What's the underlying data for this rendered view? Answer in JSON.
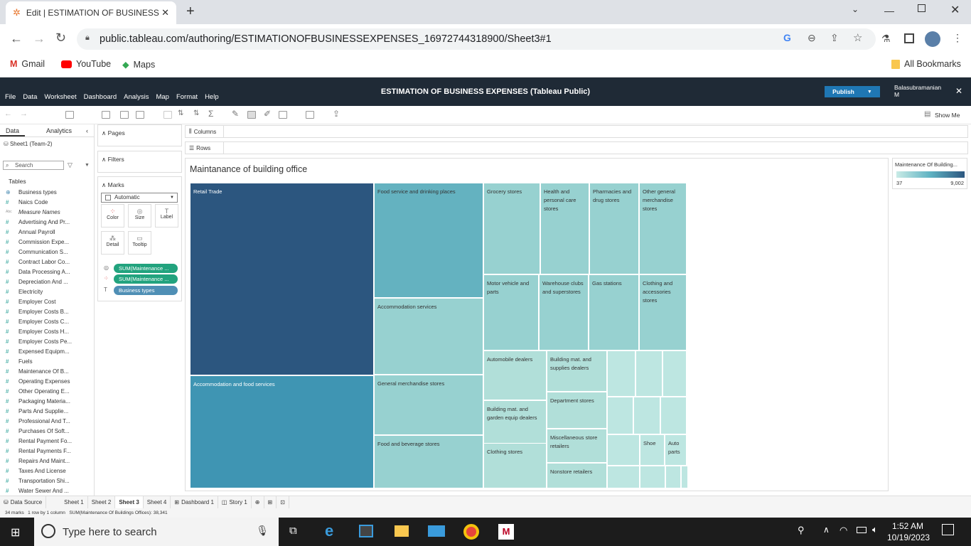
{
  "browser": {
    "tab_title": "Edit | ESTIMATION OF BUSINESS",
    "url": "public.tableau.com/authoring/ESTIMATIONOFBUSINESSEXPENSES_16972744318900/Sheet3#1",
    "bookmarks": [
      "Gmail",
      "YouTube",
      "Maps"
    ],
    "all_bookmarks": "All Bookmarks"
  },
  "app": {
    "title": "ESTIMATION OF BUSINESS EXPENSES (Tableau Public)",
    "menu": [
      "File",
      "Data",
      "Worksheet",
      "Dashboard",
      "Analysis",
      "Map",
      "Format",
      "Help"
    ],
    "publish": "Publish",
    "user_line1": "Balasubramanian",
    "user_line2": "M",
    "show_me": "Show Me"
  },
  "datapane": {
    "tab_data": "Data",
    "tab_analytics": "Analytics",
    "source": "Sheet1 (Team-2)",
    "search_placeholder": "Search",
    "tables_label": "Tables",
    "fields": [
      "Business types",
      "Naics Code",
      "Measure Names",
      "Advertising And Pr...",
      "Annual Payroll",
      "Commission Expe...",
      "Communication S...",
      "Contract Labor Co...",
      "Data Processing A...",
      "Depreciation And ...",
      "Electricity",
      "Employer Cost",
      "Employer Costs B...",
      "Employer Costs C...",
      "Employer Costs H...",
      "Employer Costs Pe...",
      "Expensed Equipm...",
      "Fuels",
      "Maintenance Of B...",
      "Operating Expenses",
      "Other Operating E...",
      "Packaging Materia...",
      "Parts And Supplie...",
      "Professional And T...",
      "Purchases Of Soft...",
      "Rental Payment Fo...",
      "Rental Payments F...",
      "Repairs And Maint...",
      "Taxes And License",
      "Transportation Shi...",
      "Water Sewer And ..."
    ],
    "field_icons": [
      "geo",
      "#",
      "Abc",
      "#",
      "#",
      "#",
      "#",
      "#",
      "#",
      "#",
      "#",
      "#",
      "#",
      "#",
      "#",
      "#",
      "#",
      "#",
      "#",
      "#",
      "#",
      "#",
      "#",
      "#",
      "#",
      "#",
      "#",
      "#",
      "#",
      "#",
      "#"
    ]
  },
  "cards": {
    "pages": "Pages",
    "filters": "Filters",
    "marks": "Marks",
    "mark_type": "Automatic",
    "buttons": [
      "Color",
      "Size",
      "Label",
      "Detail",
      "Tooltip"
    ],
    "pills": [
      "SUM(Maintenance ...",
      "SUM(Maintenance ...",
      "Business types"
    ]
  },
  "shelves": {
    "columns": "Columns",
    "rows": "Rows"
  },
  "viz": {
    "title": "Maintanance of building office",
    "legend_title": "Maintenance Of Building...",
    "legend_min": "37",
    "legend_max": "9,002"
  },
  "chart_data": {
    "type": "treemap",
    "title": "Maintanance of building office",
    "measure": "SUM(Maintenance Of Buildings Offices)",
    "color_range": [
      37,
      9002
    ],
    "labeled_categories": [
      "Retail Trade",
      "Accommodation and food services",
      "Food service and drinking places",
      "Accommodation services",
      "General merchandise stores",
      "Food and beverage stores",
      "Grocery stores",
      "Health and personal care stores",
      "Pharmacies and drug stores",
      "Other general merchandise stores",
      "Motor vehicle and parts",
      "Warehouse clubs and superstores",
      "Gas stations",
      "Clothing and accessories stores",
      "Automobile dealers",
      "Building mat. and supplies dealers",
      "Building mat. and garden equip dealers",
      "Department stores",
      "Clothing stores",
      "Miscellaneous store retailers",
      "Nonstore retailers",
      "Shoe",
      "Auto parts"
    ]
  },
  "sheet_tabs": [
    "Data Source",
    "Sheet 1",
    "Sheet 2",
    "Sheet 3",
    "Sheet 4",
    "Dashboard 1",
    "Story 1"
  ],
  "status": {
    "marks": "34 marks",
    "dims": "1 row by 1 column",
    "sum": "SUM(Maintenance Of Buildings Offices): 38,341"
  },
  "taskbar": {
    "search_placeholder": "Type here to search",
    "time": "1:52 AM",
    "date": "10/19/2023"
  }
}
